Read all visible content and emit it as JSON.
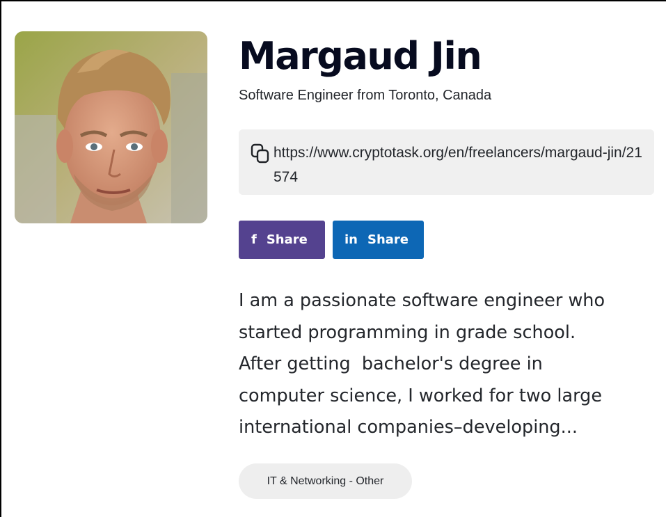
{
  "profile": {
    "name": "Margaud Jin",
    "subtitle": "Software Engineer from Toronto, Canada",
    "profile_url": "https://www.cryptotask.org/en/freelancers/margaud-jin/21574",
    "bio_lines": [
      "I am a passionate software engineer who",
      "started programming in grade school.",
      "After getting  bachelor's degree in",
      "computer science, I worked for two large",
      "international companies–developing..."
    ],
    "tag": "IT & Networking - Other"
  },
  "share": {
    "facebook": {
      "icon": "f",
      "label": "Share",
      "color": "#54428f"
    },
    "linkedin": {
      "icon": "in",
      "label": "Share",
      "color": "#0d67b5"
    }
  },
  "icons": {
    "copy": "copy-icon",
    "facebook": "facebook-icon",
    "linkedin": "linkedin-icon"
  },
  "colors": {
    "url_box_bg": "#f0f0f0",
    "tag_bg": "#eeeeee",
    "name_color": "#070b1f"
  }
}
